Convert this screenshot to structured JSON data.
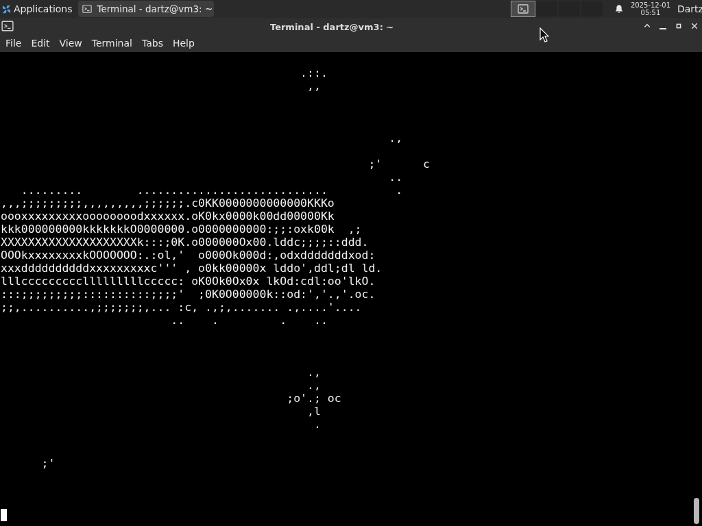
{
  "panel": {
    "apps_menu": "Applications",
    "tasks": [
      {
        "label": "Terminal - dartz@vm3: ~",
        "selected": true
      }
    ],
    "workspaces": [
      {
        "selected": true
      },
      {
        "selected": false
      },
      {
        "selected": false
      },
      {
        "selected": false
      }
    ],
    "clock": {
      "date": "2025-12-01",
      "time": "05:51"
    },
    "user": "Dartz"
  },
  "window": {
    "title": "Terminal - dartz@vm3: ~",
    "menu": [
      "File",
      "Edit",
      "View",
      "Terminal",
      "Tabs",
      "Help"
    ]
  },
  "terminal": {
    "screen_text": "\n                                            .::.\n                                             ,,\n\n\n\n                                                         .,\n\n                                                      ;'      c\n                                                         ..\n   .........        ............................          .\n,,,;;;;;;;;;,,,,,,,,,;;;;;;.c0KK0000000000000KKKo\noooxxxxxxxxxoooooooodxxxxxx.oK0kx0000k00dd00000Kk\nkkk000000000kkkkkkkO0000000.o0000000000:;;:oxk00k  ,;\nXXXXXXXXXXXXXXXXXXXXk:::;0K.o000000Ox00.lddc;;;;::ddd.\nOOOkxxxxxxxxkOOOOOOO:.:ol,'  o000Ok000d:,odxdddddddxod:\nxxxddddddddddxxxxxxxxxc''' , o0kk00000x lddo',ddl;dl ld.\nlllccccccccclllllllllccccc: oK0Ok0Ox0x lkOd:cdl:oo'lkO.\n:::;;;;;;;;;::::::::::;;;;'  ;0K0O00000k::od:','.,'.oc.\n;;,..........,;;;;;;;,... :c, .,;,....... .,....'....\n                         ..    .         .    ..\n\n\n\n                                             .,\n                                             .,\n                                          ;o'.; oc\n                                             ,l\n                                              .\n\n\n      ;'\n\n\n\n"
  }
}
